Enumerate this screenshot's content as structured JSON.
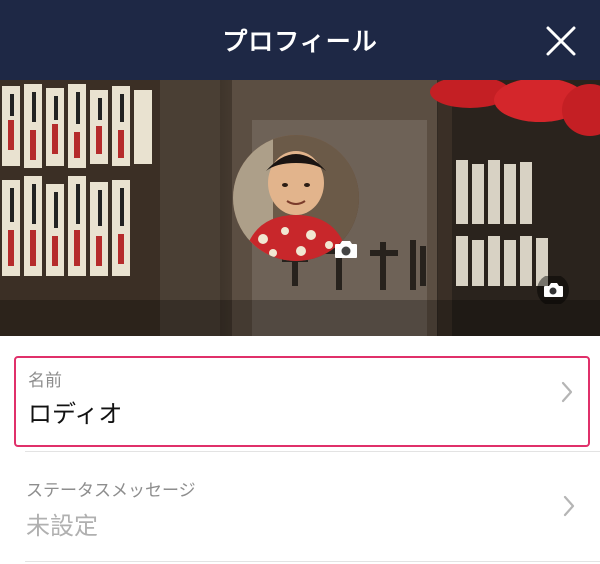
{
  "header": {
    "title": "プロフィール"
  },
  "icons": {
    "close": "close-icon",
    "camera": "camera-icon",
    "chevron": "chevron-right-icon"
  },
  "colors": {
    "header_bg": "#1e2845",
    "highlight": "#e0306a"
  },
  "profile": {
    "name_label": "名前",
    "name_value": "ロディオ",
    "status_label": "ステータスメッセージ",
    "status_value": "未設定"
  }
}
